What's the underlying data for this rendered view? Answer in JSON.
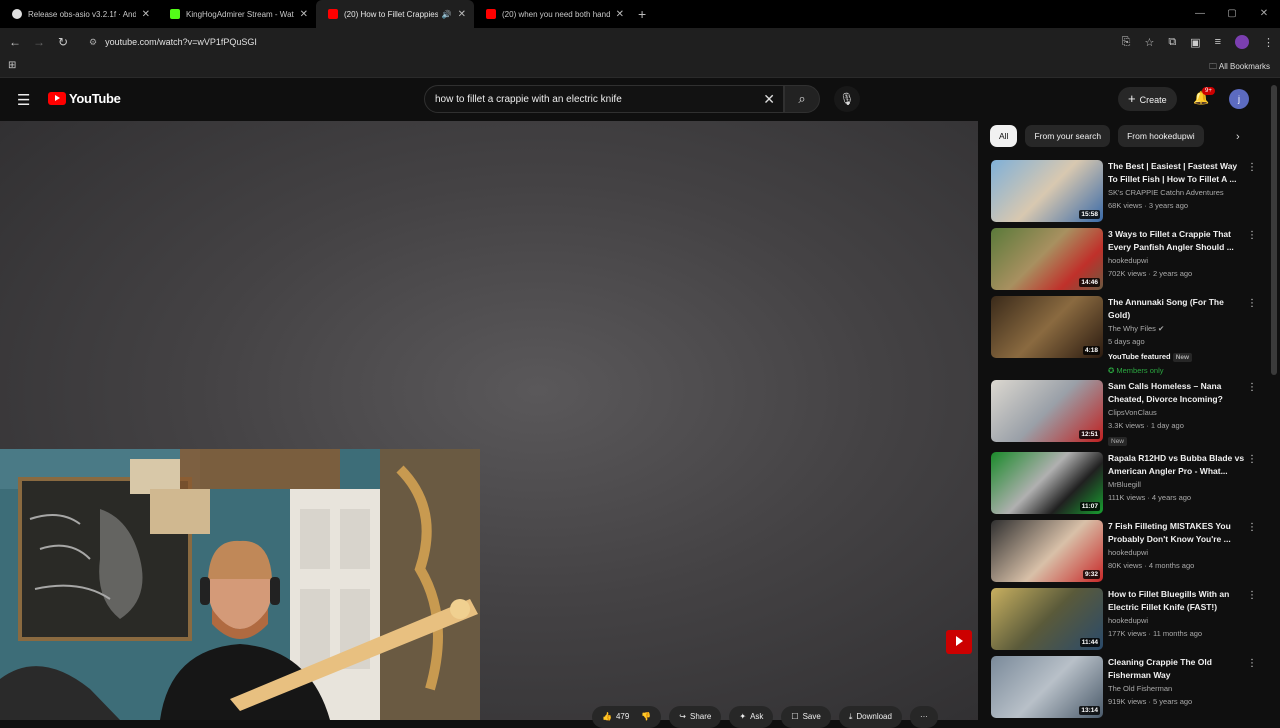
{
  "browser": {
    "tabs": [
      {
        "title": "Release obs-asio v3.2.1f · Ande",
        "color": "#e0e0e0",
        "active": false
      },
      {
        "title": "KingHogAdmirer Stream - Wat",
        "color": "#53fc18",
        "active": false
      },
      {
        "title": "(20) How to Fillet Crappies",
        "color": "#ff0000",
        "active": true
      },
      {
        "title": "(20) when you need both hand",
        "color": "#ff0000",
        "active": false
      }
    ],
    "url": "youtube.com/watch?v=wVP1fPQuSGI",
    "all_bookmarks": "All Bookmarks"
  },
  "header": {
    "logo_text": "YouTube",
    "search_query": "how to fillet a crappie with an electric knife",
    "create_label": "Create",
    "notif_badge": "9+",
    "avatar_letter": "j"
  },
  "actions": {
    "likes": "479",
    "share": "Share",
    "ask": "Ask",
    "save": "Save",
    "download": "Download"
  },
  "chips": [
    "All",
    "From your search",
    "From hookedupwi"
  ],
  "recommendations": [
    {
      "title": "The Best | Easiest | Fastest Way To Fillet Fish | How To Fillet A ...",
      "channel": "SK's CRAPPIE Catchn Adventures",
      "views": "68K views · 3 years ago",
      "duration": "15:58",
      "thumb": "linear-gradient(135deg,#7fb0d8,#d8c8b0 50%,#3a6aa8)"
    },
    {
      "title": "3 Ways to Fillet a Crappie That Every Panfish Angler Should ...",
      "channel": "hookedupwi",
      "views": "702K views · 2 years ago",
      "duration": "14:46",
      "thumb": "linear-gradient(135deg,#5a7a3a,#a89060 45%,#c0302a 75%,#6a5a40)"
    },
    {
      "title": "The Annunaki Song (For The Gold)",
      "channel": "The Why Files",
      "views": "5 days ago",
      "extra1": "YouTube featured",
      "extra2": "New",
      "extra3": "Members only",
      "duration": "4:18",
      "thumb": "linear-gradient(135deg,#3a2a1a,#8a6a40 50%,#2a1a10)"
    },
    {
      "title": "Sam Calls Homeless – Nana Cheated, Divorce Incoming?",
      "channel": "ClipsVonClaus",
      "views": "3.3K views · 1 day ago",
      "badge": "New",
      "duration": "12:51",
      "thumb": "linear-gradient(135deg,#dcd8d0,#9aa0a8 50%,#c02020)"
    },
    {
      "title": "Rapala R12HD vs Bubba Blade vs American Angler Pro - What...",
      "channel": "MrBluegill",
      "views": "111K views · 4 years ago",
      "duration": "11:07",
      "thumb": "linear-gradient(135deg,#1a8a2a,#b0b0b0 45%,#202020 70%,#18a030)"
    },
    {
      "title": "7 Fish Filleting MISTAKES You Probably Don't Know You're ...",
      "channel": "hookedupwi",
      "views": "80K views · 4 months ago",
      "duration": "9:32",
      "thumb": "linear-gradient(135deg,#303030,#d8c0a8 55%,#c82828)"
    },
    {
      "title": "How to Fillet Bluegills With an Electric Fillet Knife (FAST!)",
      "channel": "hookedupwi",
      "views": "177K views · 11 months ago",
      "duration": "11:44",
      "thumb": "linear-gradient(135deg,#c8b060,#5a5a3a 50%,#2a4a6a)"
    },
    {
      "title": "Cleaning Crappie The Old Fisherman Way",
      "channel": "The Old Fisherman",
      "views": "919K views · 5 years ago",
      "duration": "13:14",
      "thumb": "linear-gradient(135deg,#7a8a9a,#b8c0c8 50%,#4a5a6a)"
    }
  ]
}
